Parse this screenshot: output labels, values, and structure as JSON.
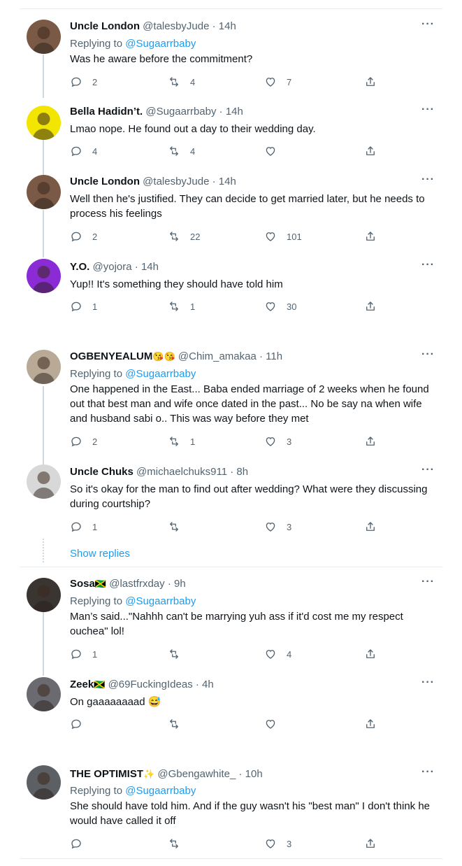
{
  "tweets": [
    {
      "name": "Uncle London",
      "handle": "@talesbyJude",
      "time": "14h",
      "replying_label": "Replying to",
      "replying_to": "@Sugaarrbaby",
      "text": "Was he aware before the commitment?",
      "replies": "2",
      "retweets": "4",
      "likes": "7",
      "avatar_color": "#7a5a46"
    },
    {
      "name": "Bella Hadidn’t.",
      "handle": "@Sugaarrbaby",
      "time": "14h",
      "replying_label": "",
      "replying_to": "",
      "text": "Lmao nope. He found out a day to their wedding day.",
      "replies": "4",
      "retweets": "4",
      "likes": "",
      "avatar_color": "#f2e600"
    },
    {
      "name": "Uncle London",
      "handle": "@talesbyJude",
      "time": "14h",
      "replying_label": "",
      "replying_to": "",
      "text": "Well then he's justified. They can decide to get married later, but he needs to process his feelings",
      "replies": "2",
      "retweets": "22",
      "likes": "101",
      "avatar_color": "#7a5a46"
    },
    {
      "name": "Y.O.",
      "handle": "@yojora",
      "time": "14h",
      "replying_label": "",
      "replying_to": "",
      "text": "Yup!! It's something they should have told him",
      "replies": "1",
      "retweets": "1",
      "likes": "30",
      "avatar_color": "#8a2bd6"
    },
    {
      "name": "OGBENYEALUM",
      "handle": "@Chim_amakaa",
      "time": "11h",
      "replying_label": "Replying to",
      "replying_to": "@Sugaarrbaby",
      "text": "One happened in the East... Baba ended marriage of 2 weeks when he found out that best man and wife once dated in the past... No be say na when wife and husband sabi o.. This was way before they met",
      "replies": "2",
      "retweets": "1",
      "likes": "3",
      "avatar_color": "#b9aa97"
    },
    {
      "name": "Uncle Chuks",
      "handle": "@michaelchuks911",
      "time": "8h",
      "replying_label": "",
      "replying_to": "",
      "text": "So it's okay for the man to find out after wedding? What were they discussing during courtship?",
      "replies": "1",
      "retweets": "",
      "likes": "3",
      "avatar_color": "#d8d8d8"
    },
    {
      "name": "Sosa",
      "handle": "@lastfrxday",
      "time": "9h",
      "replying_label": "Replying to",
      "replying_to": "@Sugaarrbaby",
      "text": "Man’s said...\"Nahhh can't be marrying yuh ass if it'd cost me my respect ouchea\" lol!",
      "replies": "1",
      "retweets": "",
      "likes": "4",
      "avatar_color": "#3a3531"
    },
    {
      "name": "Zeek",
      "handle": "@69FuckingIdeas",
      "time": "4h",
      "replying_label": "",
      "replying_to": "",
      "text": "On gaaaaaaaad 😅",
      "replies": "",
      "retweets": "",
      "likes": "",
      "avatar_color": "#6b6a70"
    },
    {
      "name": "THE OPTIMIST",
      "handle": "@Gbengawhite_",
      "time": "10h",
      "replying_label": "Replying to",
      "replying_to": "@Sugaarrbaby",
      "text": "She should have told him. And if the guy wasn't his \"best man\" I don't think he would have called it off",
      "replies": "",
      "retweets": "",
      "likes": "3",
      "avatar_color": "#5c5f63"
    }
  ],
  "show_replies": "Show replies",
  "more_label": "···",
  "dot_sep": "·",
  "emoji": {
    "ogbenye": "😘😘",
    "sosa_flag": "🇯🇲",
    "zeek_flag": "🇯🇲",
    "optimist": "✨"
  },
  "icons": {
    "reply": "reply-icon",
    "retweet": "retweet-icon",
    "like": "heart-icon",
    "share": "share-icon",
    "more": "more-icon"
  },
  "colors": {
    "link": "#1d9bf0",
    "secondary": "#536471",
    "text": "#0f1419",
    "line": "#cfd9de"
  }
}
